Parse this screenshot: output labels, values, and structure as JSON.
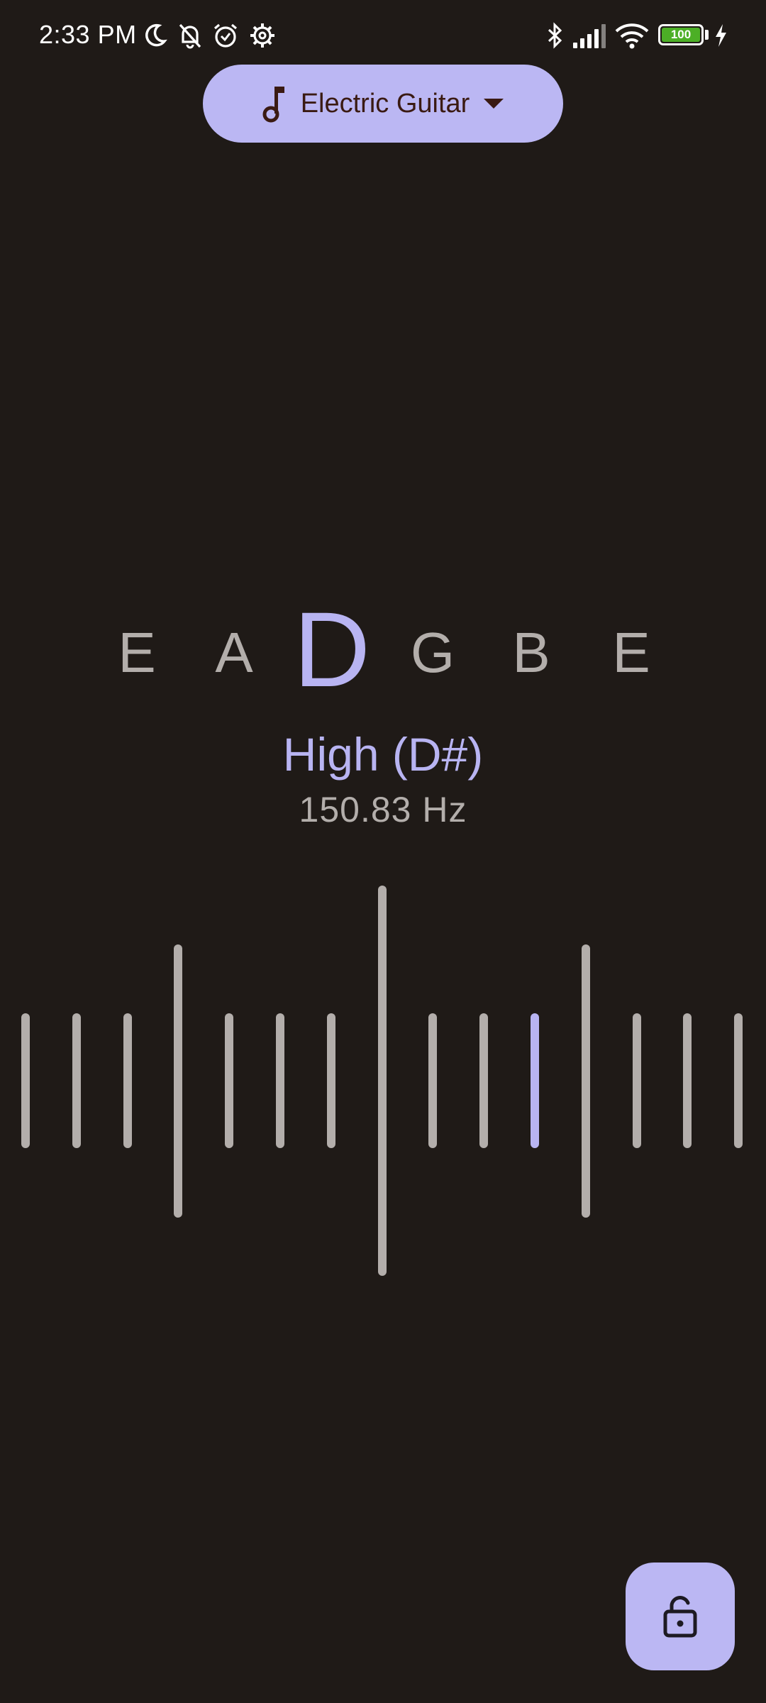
{
  "status_bar": {
    "time": "2:33 PM",
    "battery_level": "100",
    "icons": [
      "moon-icon",
      "bell-off-icon",
      "alarm-icon",
      "settings-gear-icon",
      "bluetooth-icon",
      "signal-icon",
      "wifi-icon",
      "battery-icon",
      "charging-bolt-icon"
    ]
  },
  "instrument_selector": {
    "label": "Electric Guitar",
    "icon": "music-note-icon",
    "dropdown_icon": "dropdown-arrow-icon"
  },
  "strings": [
    {
      "note": "E",
      "active": false
    },
    {
      "note": "A",
      "active": false
    },
    {
      "note": "D",
      "active": true
    },
    {
      "note": "G",
      "active": false
    },
    {
      "note": "B",
      "active": false
    },
    {
      "note": "E",
      "active": false
    }
  ],
  "tuning": {
    "status": "High (D#)",
    "frequency": "150.83 Hz"
  },
  "meter": {
    "tick_count": 15,
    "center_index": 7,
    "indicator_index": 10
  },
  "lock_button": {
    "icon": "unlock-icon"
  },
  "colors": {
    "background": "#1f1a17",
    "accent": "#b8b4f2",
    "chip": "#bbb7f3",
    "inactive": "#b3aeab",
    "battery": "#4caf26"
  }
}
